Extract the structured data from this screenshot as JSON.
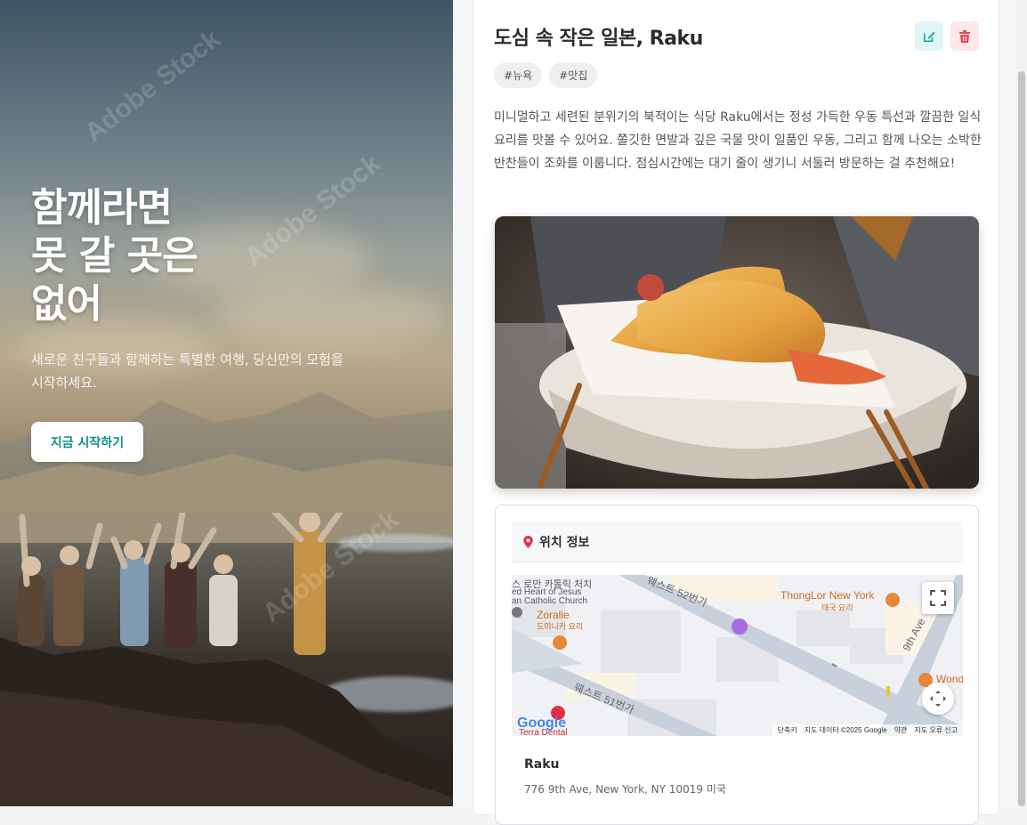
{
  "hero": {
    "title_line1": "함께라면",
    "title_line2": "못 갈 곳은",
    "title_line3": "없어",
    "subtitle": "새로운 친구들과 함께하는 특별한 여행, 당신만의 모험을 시작하세요.",
    "cta_label": "지금 시작하기",
    "watermark": "Adobe Stock"
  },
  "post": {
    "title": "도심 속 작은 일본, Raku",
    "tags": [
      "#뉴욕",
      "#맛집"
    ],
    "description": "미니멀하고 세련된 분위기의 북적이는 식당 Raku에서는 정성 가득한 우동 특선과 깔끔한 일식 요리를 맛볼 수 있어요. 쫄깃한 면발과 깊은 국물 맛이 일품인 우동, 그리고 함께 나오는 소박한 반찬들이 조화를 이룹니다. 점심시간에는 대기 줄이 생기니 서둘러 방문하는 걸 추천해요!",
    "edit_icon": "edit-icon",
    "delete_icon": "trash-icon"
  },
  "location": {
    "header": "위치 정보",
    "place_name": "Raku",
    "address": "776 9th Ave, New York, NY 10019 미국",
    "map": {
      "labels": {
        "church_ko": "스 로만 카톨릭 처치",
        "church_en1": "ed Heart of Jesus",
        "church_en2": "an Catholic Church",
        "zoralie": "Zoralie",
        "zoralie_sub": "도미니카 요리",
        "thonglor": "ThongLor New York",
        "thonglor_sub": "태국 요리",
        "street_52": "웨스트 52번가",
        "street_51": "웨스트 51번가",
        "ave_9": "9th Ave",
        "wond": "Wond",
        "terra": "Terra Dental",
        "google": "Google"
      },
      "attribution": {
        "shortcuts": "단축키",
        "data": "지도 데이터 ©2025 Google",
        "terms": "약관",
        "report": "지도 오류 신고"
      }
    }
  },
  "colors": {
    "accent_teal": "#0f8f86",
    "danger_red": "#e04a55",
    "pin_red": "#e0314b"
  }
}
